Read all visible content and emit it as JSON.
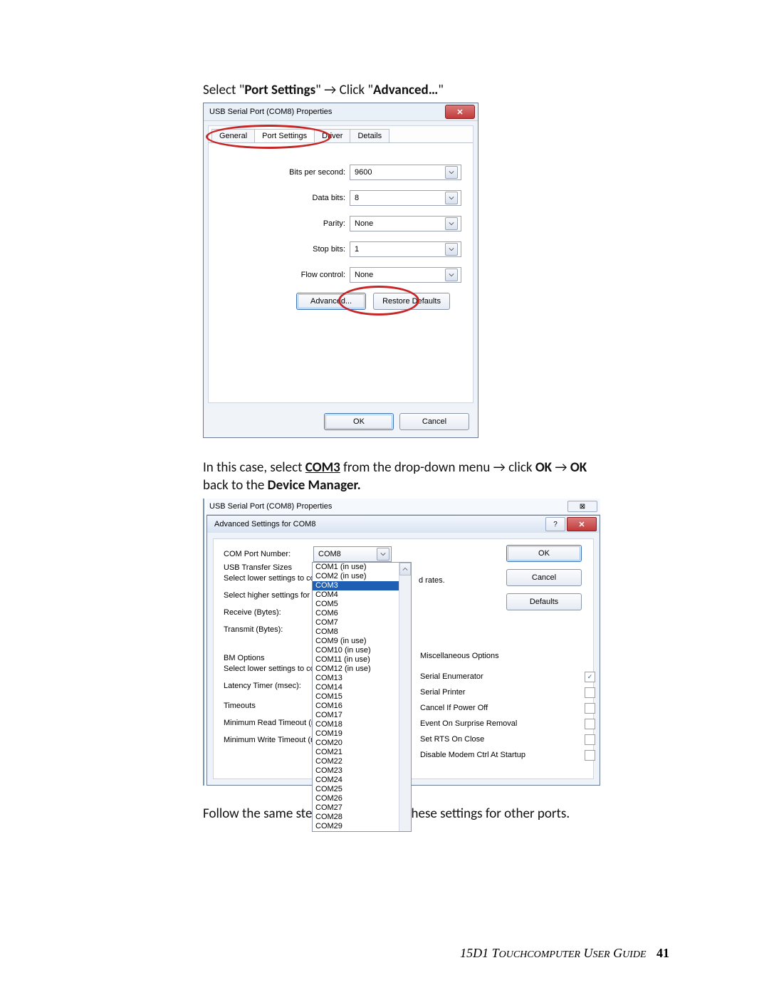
{
  "instruction1": {
    "pre": "Select \"",
    "bold1": "Port Settings",
    "mid": "\" → Click \"",
    "bold2": "Advanced…",
    "post": "\""
  },
  "dlg1": {
    "title": "USB Serial Port (COM8) Properties",
    "tabs": {
      "general": "General",
      "port": "Port Settings",
      "driver": "Driver",
      "details": "Details"
    },
    "fields": {
      "bps_label": "Bits per second:",
      "bps_value": "9600",
      "databits_label": "Data bits:",
      "databits_value": "8",
      "parity_label": "Parity:",
      "parity_value": "None",
      "stopbits_label": "Stop bits:",
      "stopbits_value": "1",
      "flow_label": "Flow control:",
      "flow_value": "None"
    },
    "buttons": {
      "advanced": "Advanced...",
      "restore": "Restore Defaults",
      "ok": "OK",
      "cancel": "Cancel"
    }
  },
  "instruction2": {
    "line1_a": "In this case, select ",
    "line1_bold": "COM3",
    "line1_b": " from the drop-down menu → click ",
    "line1_ok": "OK",
    "line1_arrow": " → ",
    "line1_ok2": "OK",
    "line2_a": "back to the ",
    "line2_bold": "Device Manager.",
    "line2_end": ""
  },
  "dlg2": {
    "parent_title": "USB Serial Port (COM8) Properties",
    "title": "Advanced Settings for COM8",
    "left": {
      "com_port_label": "COM Port Number:",
      "com_port_value": "COM8",
      "usb_transfer": "USB Transfer Sizes",
      "lower": "Select lower settings to corre",
      "higher": "Select higher settings for fas",
      "receive": "Receive (Bytes):",
      "transmit": "Transmit (Bytes):",
      "bm": "BM Options",
      "lower2": "Select lower settings to corre",
      "latency": "Latency Timer (msec):",
      "timeouts": "Timeouts",
      "min_read": "Minimum Read Timeout (msec",
      "min_write": "Minimum Write Timeout (mse"
    },
    "drates": "d rates.",
    "list": [
      "COM1 (in use)",
      "COM2 (in use)",
      "COM3",
      "COM4",
      "COM5",
      "COM6",
      "COM7",
      "COM8",
      "COM9 (in use)",
      "COM10 (in use)",
      "COM11 (in use)",
      "COM12 (in use)",
      "COM13",
      "COM14",
      "COM15",
      "COM16",
      "COM17",
      "COM18",
      "COM19",
      "COM20",
      "COM21",
      "COM22",
      "COM23",
      "COM24",
      "COM25",
      "COM26",
      "COM27",
      "COM28",
      "COM29"
    ],
    "buttons": {
      "ok": "OK",
      "cancel": "Cancel",
      "defaults": "Defaults"
    },
    "misc": {
      "header": "Miscellaneous Options",
      "rows": [
        {
          "label": "Serial Enumerator",
          "checked": true
        },
        {
          "label": "Serial Printer",
          "checked": false
        },
        {
          "label": "Cancel If Power Off",
          "checked": false
        },
        {
          "label": "Event On Surprise Removal",
          "checked": false
        },
        {
          "label": "Set RTS On Close",
          "checked": false
        },
        {
          "label": "Disable Modem Ctrl At Startup",
          "checked": false
        }
      ]
    }
  },
  "follow": "Follow the same steps to accomplish these settings for other ports.",
  "footer": {
    "text": "15D1 Touchcomputer User Guide",
    "page": "41"
  }
}
